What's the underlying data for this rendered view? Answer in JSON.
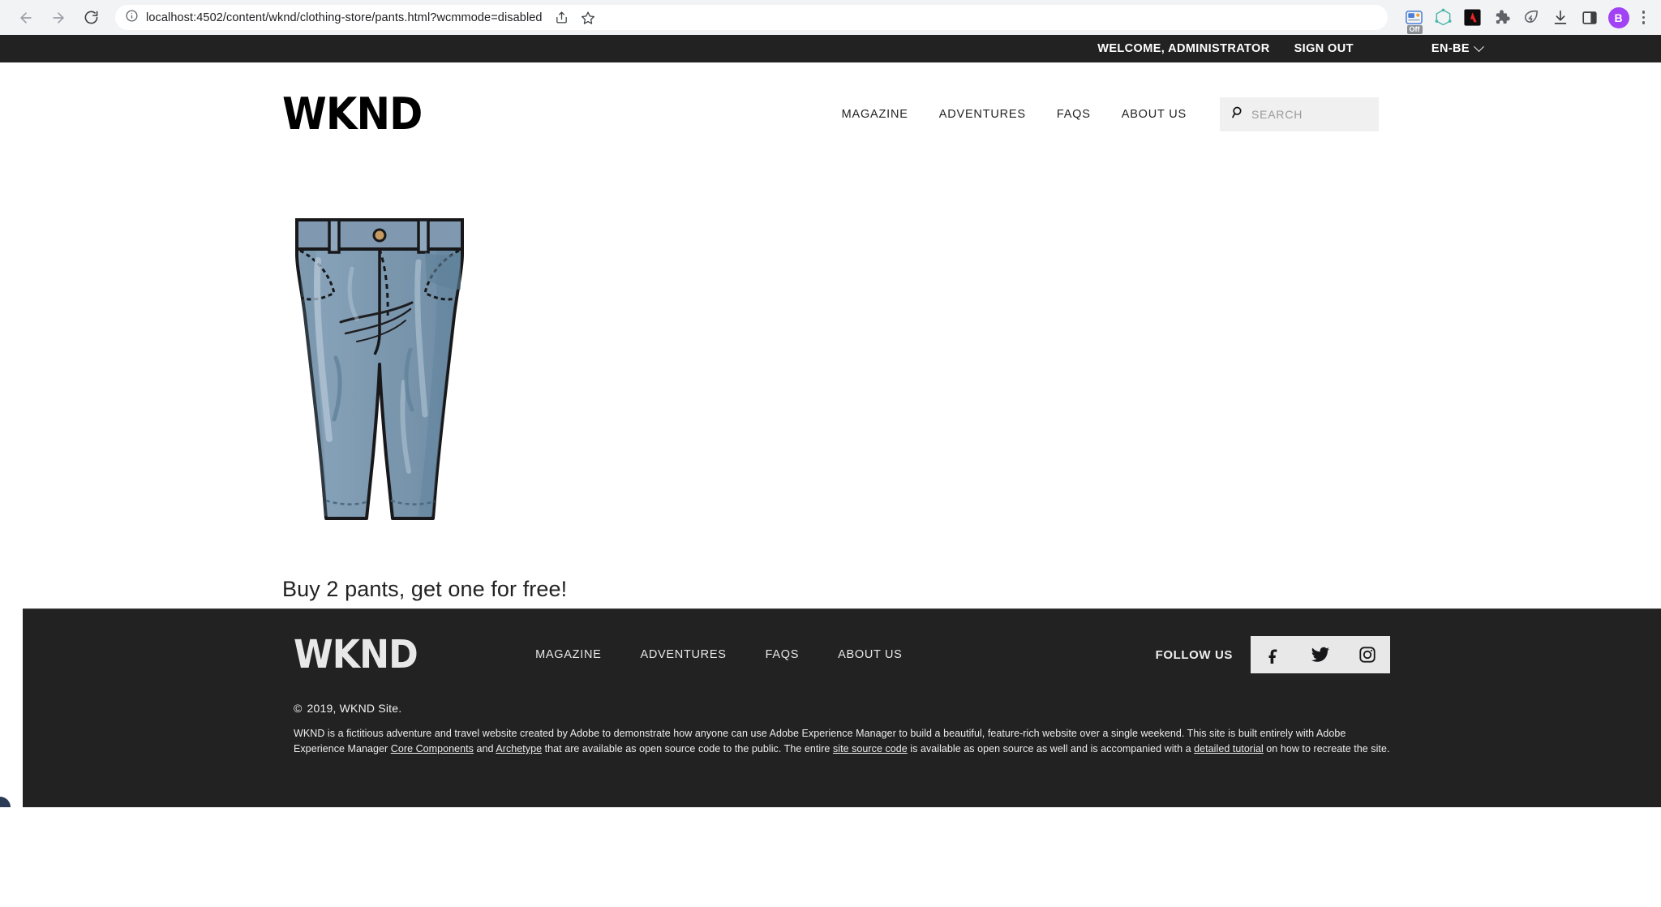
{
  "browser": {
    "back_icon": "back-arrow-icon",
    "forward_icon": "forward-arrow-icon",
    "reload_icon": "reload-icon",
    "site_info_icon": "info-circle-icon",
    "url_host": "localhost",
    "url_rest": ":4502/content/wknd/clothing-store/pants.html?wcmmode=disabled",
    "url_full": "localhost:4502/content/wknd/clothing-store/pants.html?wcmmode=disabled",
    "share_icon": "share-icon",
    "bookmark_icon": "star-icon",
    "extensions": [
      {
        "name": "screencast-extension-icon",
        "badge": "Off"
      },
      {
        "name": "graphql-extension-icon",
        "badge": ""
      },
      {
        "name": "adobe-extension-icon",
        "badge": ""
      },
      {
        "name": "puzzle-extensions-icon",
        "badge": ""
      },
      {
        "name": "lighthouse-extension-icon",
        "badge": ""
      },
      {
        "name": "downloads-icon",
        "badge": ""
      },
      {
        "name": "sidepanel-icon",
        "badge": ""
      }
    ],
    "profile_initial": "B",
    "profile_color": "#a142f4",
    "menu_icon": "kebab-menu-icon"
  },
  "utility": {
    "welcome": "WELCOME, ADMINISTRATOR",
    "sign_out": "SIGN OUT",
    "language": "EN-BE",
    "language_chevron": "chevron-down-icon"
  },
  "header": {
    "logo": "WKND",
    "nav": [
      {
        "label": "MAGAZINE"
      },
      {
        "label": "ADVENTURES"
      },
      {
        "label": "FAQS"
      },
      {
        "label": "ABOUT US"
      }
    ],
    "search": {
      "icon": "search-icon",
      "placeholder": "SEARCH",
      "value": ""
    }
  },
  "main": {
    "image_alt": "blue-jeans-pants-illustration",
    "promo_text": "Buy 2 pants, get one for free!"
  },
  "footer": {
    "logo": "WKND",
    "nav": [
      {
        "label": "MAGAZINE"
      },
      {
        "label": "ADVENTURES"
      },
      {
        "label": "FAQS"
      },
      {
        "label": "ABOUT US"
      }
    ],
    "follow_label": "FOLLOW US",
    "social": [
      {
        "name": "facebook-icon",
        "label": "Facebook"
      },
      {
        "name": "twitter-icon",
        "label": "Twitter"
      },
      {
        "name": "instagram-icon",
        "label": "Instagram"
      }
    ],
    "copyright_symbol": "©",
    "copyright_text": "2019,  WKND Site.",
    "disclaimer": {
      "part1": "WKND is a fictitious adventure and travel website created by Adobe to demonstrate how anyone can use Adobe Experience Manager to build a beautiful, feature-rich website over a single weekend. This site is built entirely with Adobe Experience Manager ",
      "link1": "Core Components",
      "part2": " and ",
      "link2": "Archetype",
      "part3": " that are available as open source code to the public. The entire ",
      "link3": "site source code",
      "part4": " is available as open source as well and is accompanied with a ",
      "link4": "detailed tutorial",
      "part5": " on how to recreate the site."
    }
  },
  "colors": {
    "dark": "#222222",
    "chrome_bg": "#f1f3f4",
    "search_bg": "#f0f0f0",
    "denim": "#7a97b0",
    "denim_dark": "#5c7e96",
    "denim_light": "#9ab3c6"
  }
}
